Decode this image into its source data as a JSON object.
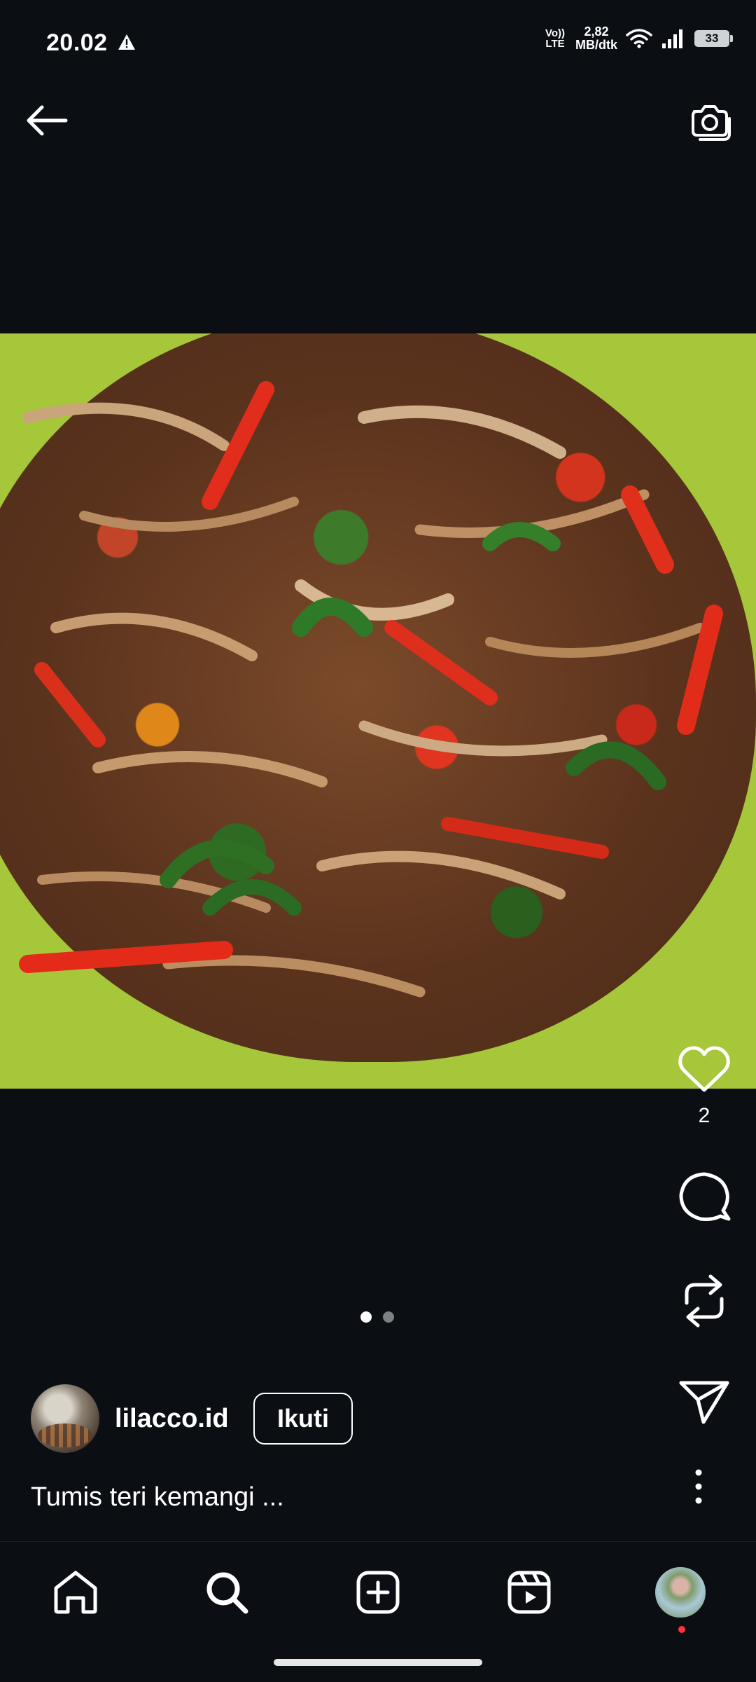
{
  "status_bar": {
    "time": "20.02",
    "volte_line1": "Vo))",
    "volte_line2": "LTE",
    "speed_value": "2,82",
    "speed_unit": "MB/dtk",
    "battery": "33"
  },
  "post": {
    "likes": "2",
    "carousel": {
      "count": 2,
      "active_index": 0
    },
    "author": {
      "username": "lilacco.id",
      "follow_label": "Ikuti"
    },
    "caption": "Tumis teri kemangi ..."
  },
  "icons": {
    "back": "arrow-left-icon",
    "camera": "camera-icon",
    "like": "heart-icon",
    "comment": "comment-icon",
    "repost": "repost-icon",
    "share": "send-icon",
    "more": "more-vertical-icon",
    "nav": [
      "home-icon",
      "search-icon",
      "create-icon",
      "reels-icon",
      "profile-avatar"
    ]
  },
  "colors": {
    "background": "#0b0f14",
    "text": "#ffffff",
    "notification_dot": "#ff3040"
  }
}
